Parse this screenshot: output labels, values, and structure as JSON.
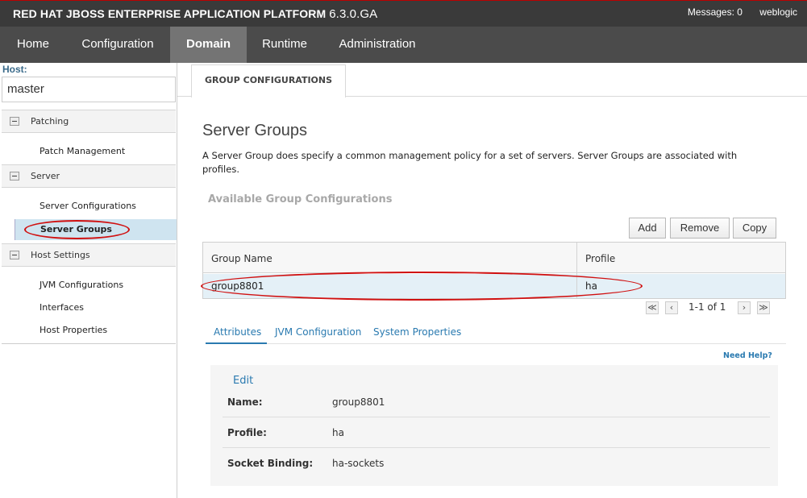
{
  "header": {
    "brand": "RED HAT JBOSS ENTERPRISE APPLICATION PLATFORM",
    "version": "6.3.0.GA",
    "messages": "Messages: 0",
    "user": "weblogic"
  },
  "nav": [
    "Home",
    "Configuration",
    "Domain",
    "Runtime",
    "Administration"
  ],
  "sidebar": {
    "host_label": "Host:",
    "host_value": "master",
    "sections": [
      {
        "label": "Patching",
        "items": [
          "Patch Management"
        ]
      },
      {
        "label": "Server",
        "items": [
          "Server Configurations",
          "Server Groups"
        ]
      },
      {
        "label": "Host Settings",
        "items": [
          "JVM Configurations",
          "Interfaces",
          "Host Properties"
        ]
      }
    ]
  },
  "main": {
    "tab": "GROUP CONFIGURATIONS",
    "title": "Server Groups",
    "description": "A Server Group does specify a common management policy for a set of servers. Server Groups are associated with profiles.",
    "available": "Available Group Configurations",
    "buttons": {
      "add": "Add",
      "remove": "Remove",
      "copy": "Copy"
    },
    "table": {
      "columns": [
        "Group Name",
        "Profile"
      ],
      "rows": [
        [
          "group8801",
          "ha"
        ]
      ]
    },
    "pager": {
      "text": "1-1 of 1",
      "first": "≪",
      "prev": "‹",
      "next": "›",
      "last": "≫"
    },
    "subtabs": [
      "Attributes",
      "JVM Configuration",
      "System Properties"
    ],
    "need_help": "Need Help?",
    "details": {
      "edit": "Edit",
      "fields": [
        {
          "label": "Name:",
          "value": "group8801"
        },
        {
          "label": "Profile:",
          "value": "ha"
        },
        {
          "label": "Socket Binding:",
          "value": "ha-sockets"
        }
      ]
    }
  }
}
